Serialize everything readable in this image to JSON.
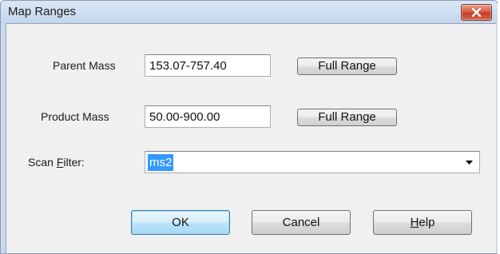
{
  "window": {
    "title": "Map Ranges"
  },
  "parent_mass": {
    "label": "Parent Mass",
    "value": "153.07-757.40",
    "button": "Full Range"
  },
  "product_mass": {
    "label": "Product Mass",
    "value": "50.00-900.00",
    "button": "Full Range"
  },
  "scan_filter": {
    "label_pre": "Scan ",
    "label_mnemonic": "F",
    "label_post": "ilter:",
    "value": "ms2"
  },
  "buttons": {
    "ok": "OK",
    "cancel": "Cancel",
    "help_mnemonic": "H",
    "help_rest": "elp"
  },
  "icons": {
    "close": "close-x-icon",
    "dropdown": "dropdown-arrow-icon"
  },
  "colors": {
    "selection": "#3399ff",
    "close_button": "#d2543c",
    "titlebar": "#c9d9ee"
  }
}
